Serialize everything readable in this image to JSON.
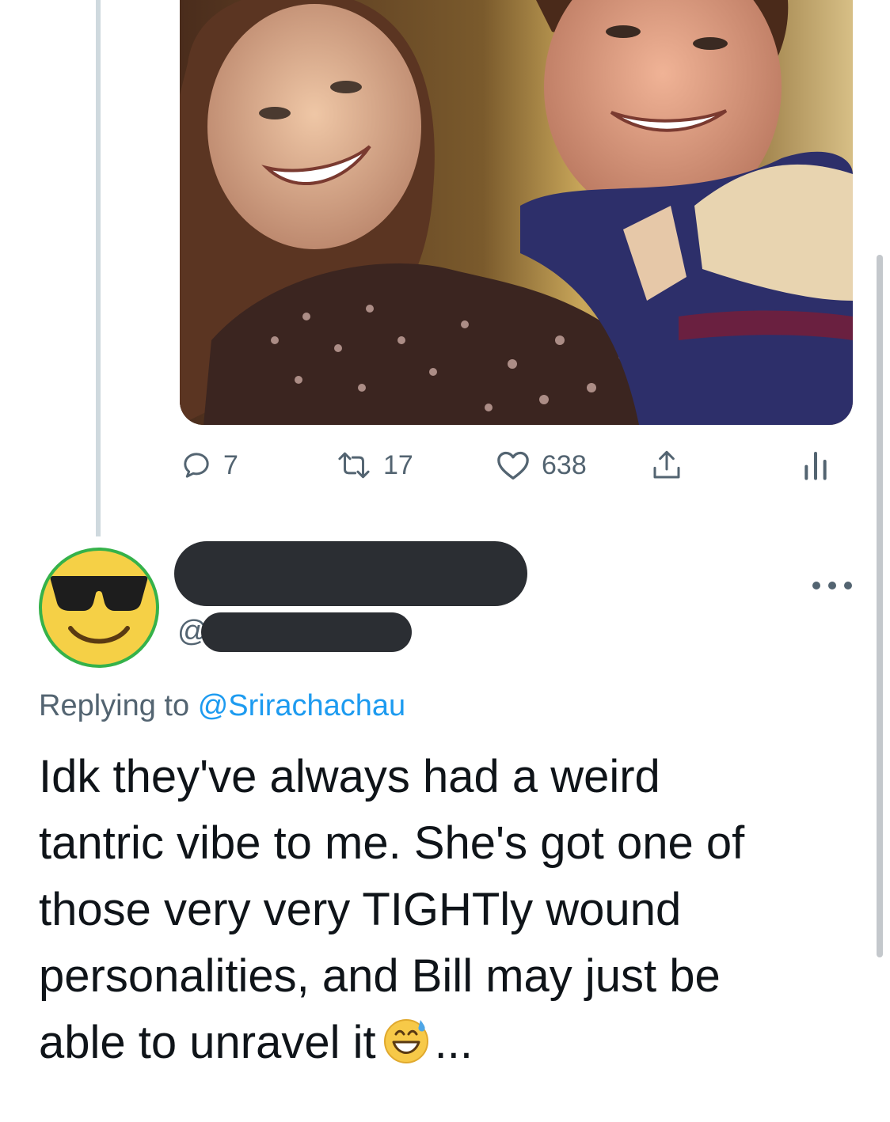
{
  "tweet_actions": {
    "reply_count": "7",
    "retweet_count": "17",
    "like_count": "638"
  },
  "reply": {
    "handle_prefix": "@",
    "replying_to_label": "Replying to",
    "replying_to_handle": "@Srirachachau",
    "text_lines": [
      "Idk they've always had a weird",
      "tantric vibe to me. She's got one of",
      "those very very TIGHTly wound",
      "personalities, and Bill may just be",
      "able to unravel it"
    ],
    "text_suffix": "...",
    "inline_emoji": "grinning-face-with-sweat-icon",
    "avatar_emoji": "smiling-face-with-sunglasses-icon"
  },
  "colors": {
    "secondary_text": "#536471",
    "link": "#1d9bf0",
    "primary_text": "#0f1419",
    "redaction": "#2b2e33",
    "thread_line": "#cfd9de"
  }
}
